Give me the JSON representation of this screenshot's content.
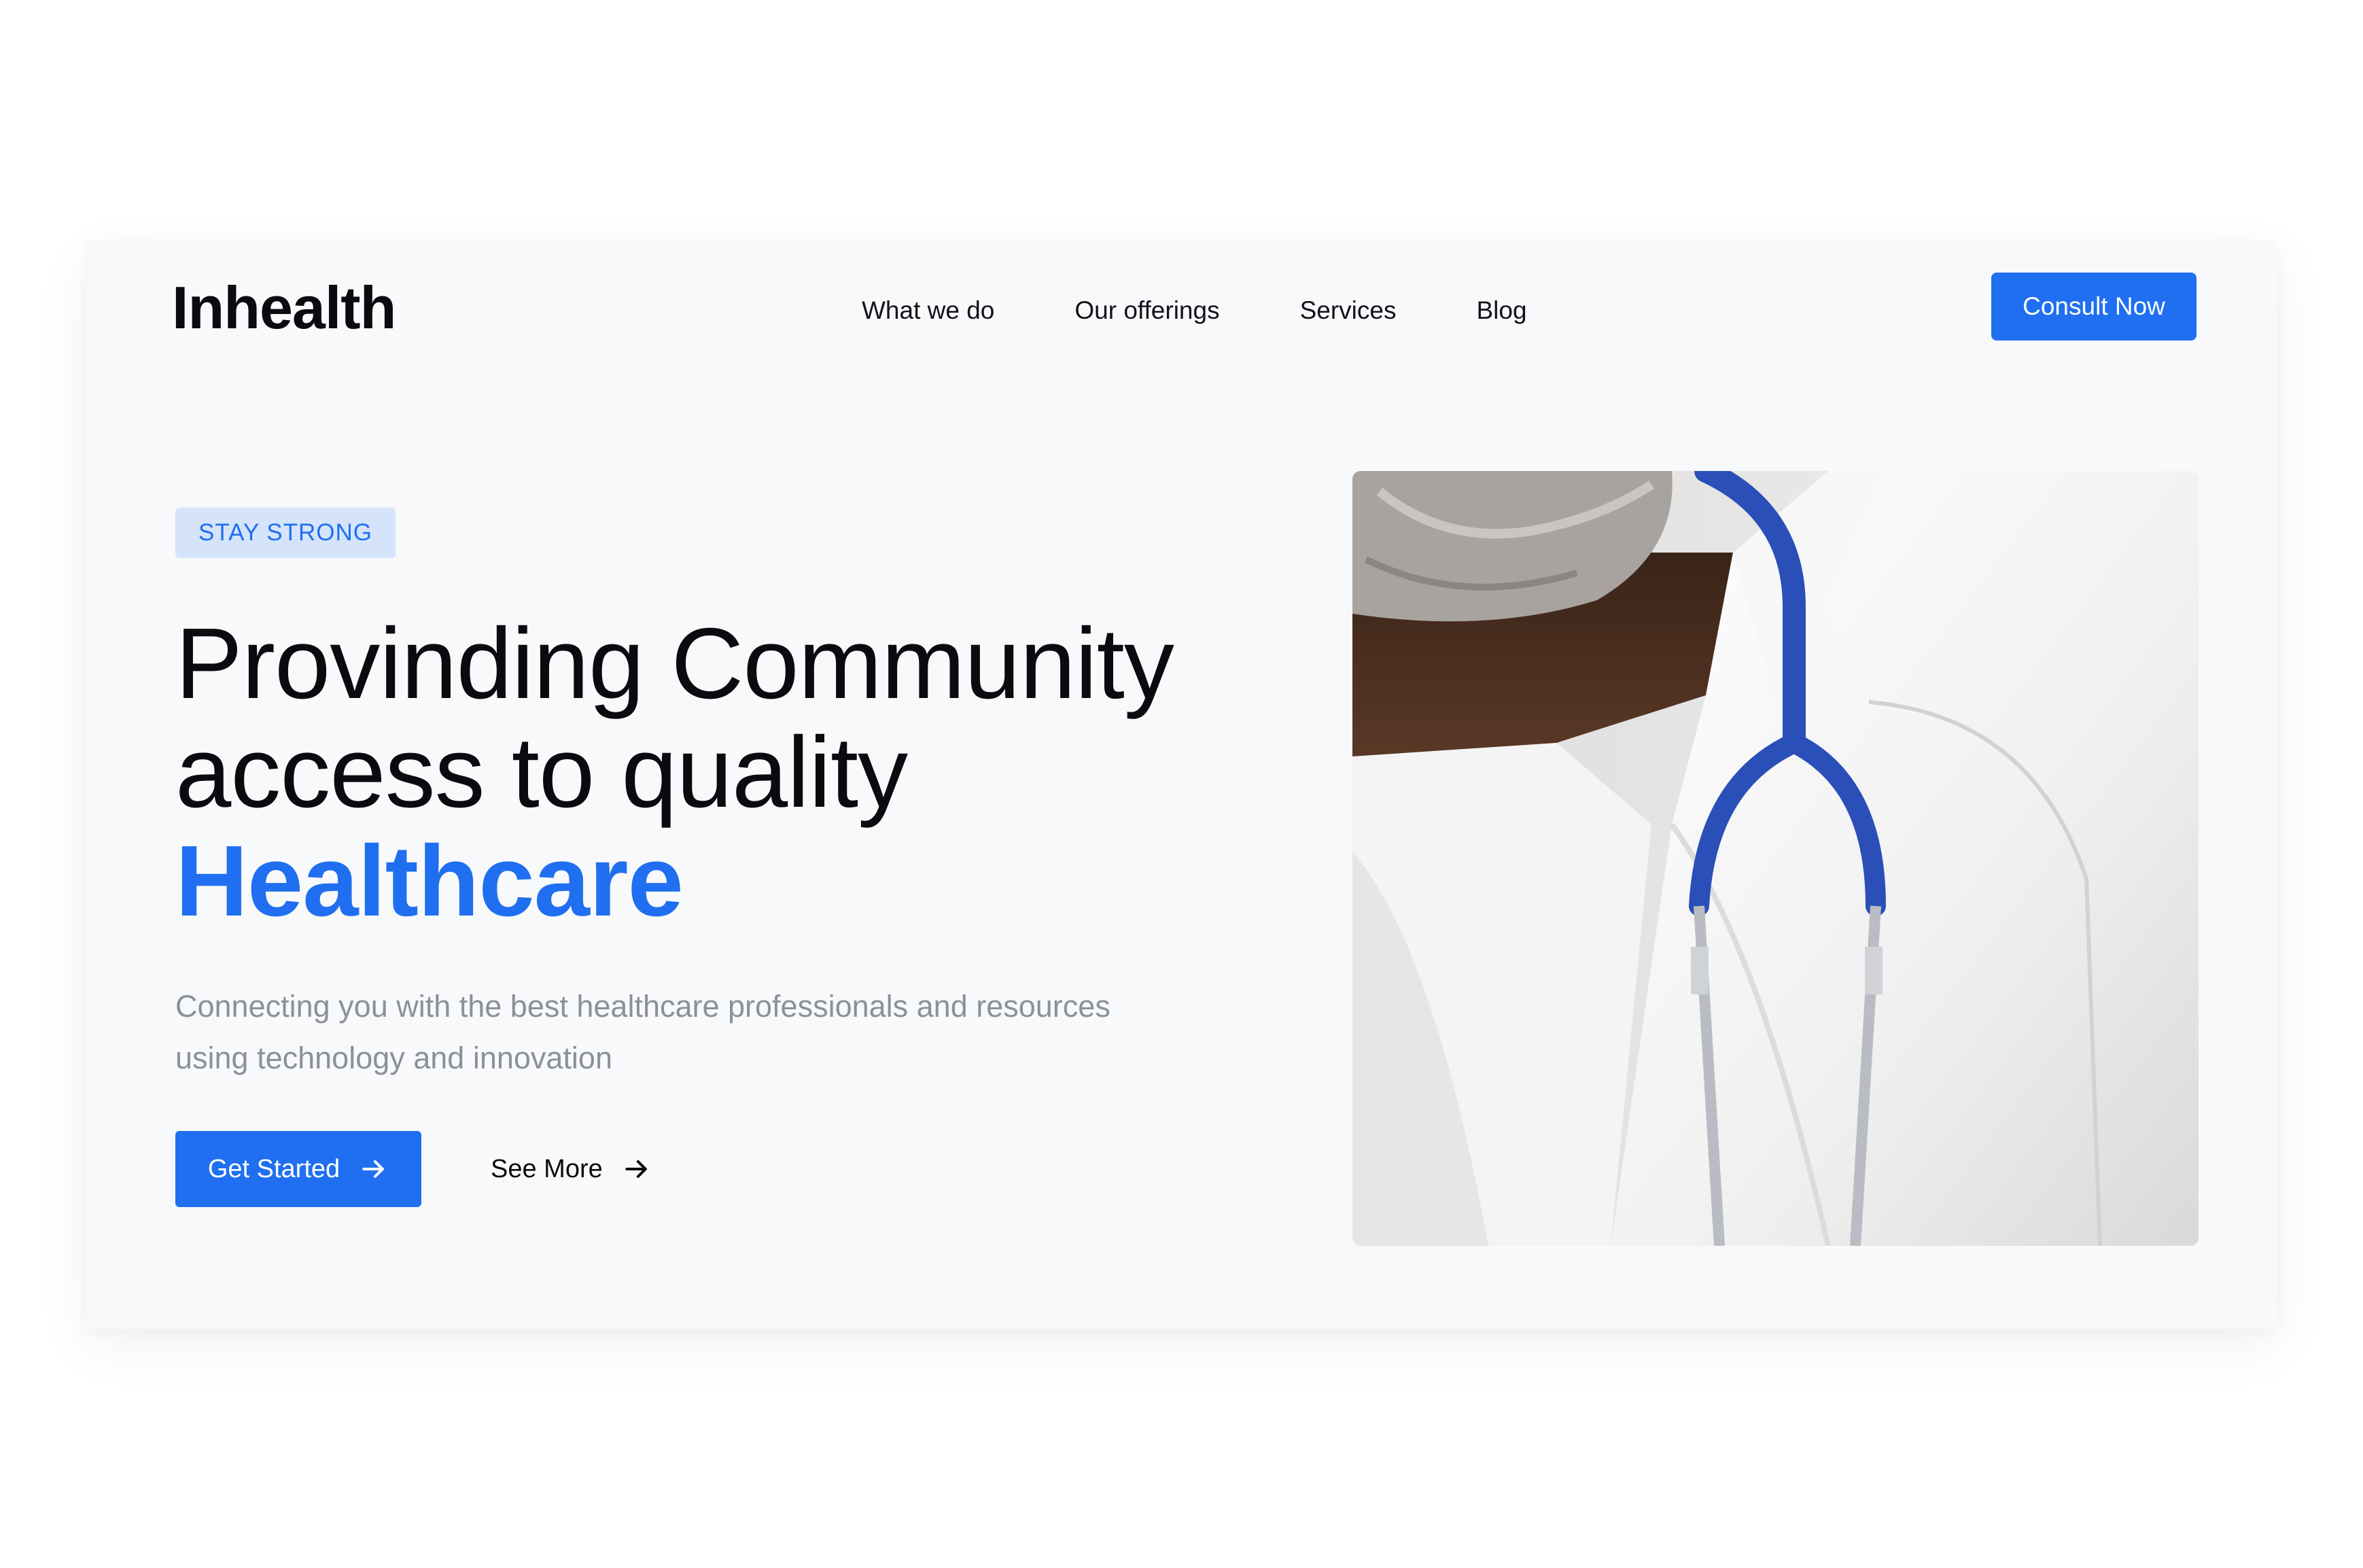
{
  "brand": {
    "logo_text": "Inhealth"
  },
  "nav": {
    "items": [
      {
        "label": "What we do"
      },
      {
        "label": "Our offerings"
      },
      {
        "label": "Services"
      },
      {
        "label": "Blog"
      }
    ],
    "cta_label": "Consult Now"
  },
  "hero": {
    "tag": "STAY STRONG",
    "headline_line1": "Provinding Community",
    "headline_line2": "access to quality",
    "headline_accent": "Healthcare",
    "description": "Connecting you with the best healthcare professionals and resources using technology and innovation",
    "primary_button": "Get Started",
    "secondary_button": "See More",
    "image_subject": "doctor-with-stethoscope"
  },
  "colors": {
    "accent": "#1f6ff0",
    "tag_background": "#d6e4fb",
    "card_background": "#f8f9fb",
    "muted_text": "#8c9098"
  }
}
